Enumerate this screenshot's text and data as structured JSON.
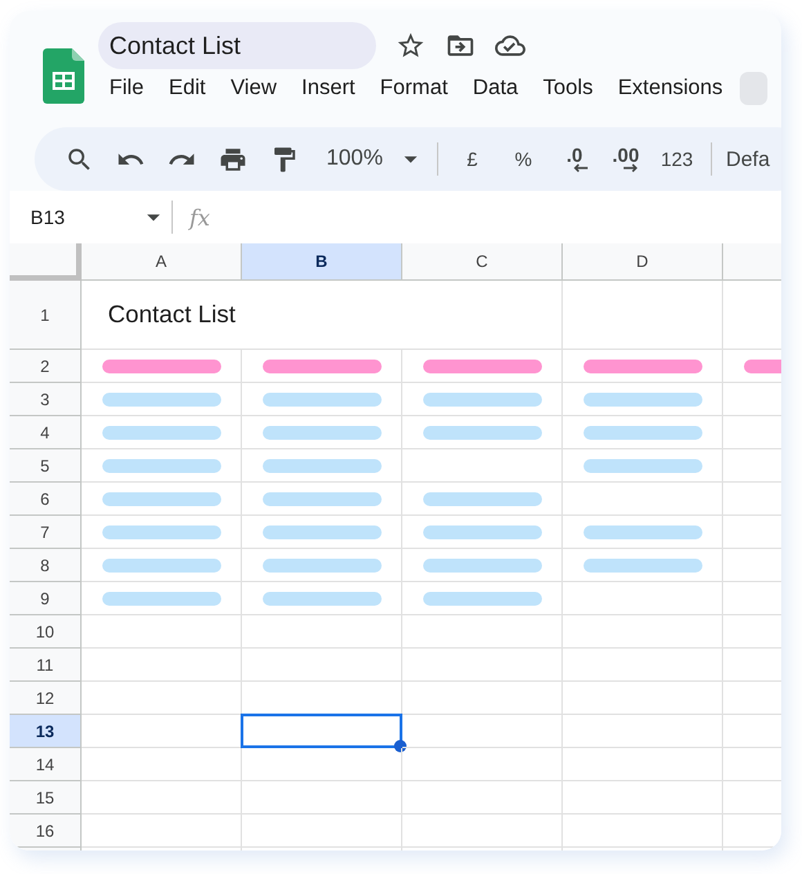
{
  "document": {
    "title": "Contact List"
  },
  "menu": [
    "File",
    "Edit",
    "View",
    "Insert",
    "Format",
    "Data",
    "Tools",
    "Extensions"
  ],
  "toolbar": [
    {
      "kind": "search"
    },
    {
      "kind": "undo"
    },
    {
      "kind": "redo"
    },
    {
      "kind": "print"
    },
    {
      "kind": "paint-format"
    },
    {
      "kind": "zoom",
      "text": "100%"
    },
    {
      "kind": "divider"
    },
    {
      "kind": "text",
      "text": "£"
    },
    {
      "kind": "text",
      "text": "%"
    },
    {
      "kind": "decimal-decrease",
      "text": ".0"
    },
    {
      "kind": "decimal-increase",
      "text": ".00"
    },
    {
      "kind": "text",
      "text": "123"
    },
    {
      "kind": "divider"
    },
    {
      "kind": "font",
      "text": "Defa"
    }
  ],
  "name_box": "B13",
  "formula_label": "fx",
  "columns": [
    {
      "label": "A",
      "selected": false
    },
    {
      "label": "B",
      "selected": true
    },
    {
      "label": "C",
      "selected": false
    },
    {
      "label": "D",
      "selected": false
    },
    {
      "selected": false
    }
  ],
  "title_row": {
    "label": "1",
    "text": "Contact List"
  },
  "rows": [
    {
      "label": "2",
      "selected": false,
      "cells": [
        {
          "kind": "header"
        },
        {
          "kind": "header"
        },
        {
          "kind": "header"
        },
        {
          "kind": "header"
        },
        {
          "kind": "header"
        }
      ]
    },
    {
      "label": "3",
      "selected": false,
      "cells": [
        {
          "kind": "value"
        },
        {
          "kind": "value"
        },
        {
          "kind": "value"
        },
        {
          "kind": "value"
        },
        {
          "kind": "blank"
        }
      ]
    },
    {
      "label": "4",
      "selected": false,
      "cells": [
        {
          "kind": "value"
        },
        {
          "kind": "value"
        },
        {
          "kind": "value"
        },
        {
          "kind": "value"
        },
        {
          "kind": "blank"
        }
      ]
    },
    {
      "label": "5",
      "selected": false,
      "cells": [
        {
          "kind": "value"
        },
        {
          "kind": "value"
        },
        {
          "kind": "blank"
        },
        {
          "kind": "value"
        },
        {
          "kind": "blank"
        }
      ]
    },
    {
      "label": "6",
      "selected": false,
      "cells": [
        {
          "kind": "value"
        },
        {
          "kind": "value"
        },
        {
          "kind": "value"
        },
        {
          "kind": "blank"
        },
        {
          "kind": "blank"
        }
      ]
    },
    {
      "label": "7",
      "selected": false,
      "cells": [
        {
          "kind": "value"
        },
        {
          "kind": "value"
        },
        {
          "kind": "value"
        },
        {
          "kind": "value"
        },
        {
          "kind": "blank"
        }
      ]
    },
    {
      "label": "8",
      "selected": false,
      "cells": [
        {
          "kind": "value"
        },
        {
          "kind": "value"
        },
        {
          "kind": "value"
        },
        {
          "kind": "value"
        },
        {
          "kind": "blank"
        }
      ]
    },
    {
      "label": "9",
      "selected": false,
      "cells": [
        {
          "kind": "value"
        },
        {
          "kind": "value"
        },
        {
          "kind": "value"
        },
        {
          "kind": "blank"
        },
        {
          "kind": "blank"
        }
      ]
    },
    {
      "label": "10",
      "selected": false,
      "cells": [
        {
          "kind": "blank"
        },
        {
          "kind": "blank"
        },
        {
          "kind": "blank"
        },
        {
          "kind": "blank"
        },
        {
          "kind": "blank"
        }
      ]
    },
    {
      "label": "11",
      "selected": false,
      "cells": [
        {
          "kind": "blank"
        },
        {
          "kind": "blank"
        },
        {
          "kind": "blank"
        },
        {
          "kind": "blank"
        },
        {
          "kind": "blank"
        }
      ]
    },
    {
      "label": "12",
      "selected": false,
      "cells": [
        {
          "kind": "blank"
        },
        {
          "kind": "blank"
        },
        {
          "kind": "blank"
        },
        {
          "kind": "blank"
        },
        {
          "kind": "blank"
        }
      ]
    },
    {
      "label": "13",
      "selected": true,
      "cells": [
        {
          "kind": "blank"
        },
        {
          "kind": "blank"
        },
        {
          "kind": "blank"
        },
        {
          "kind": "blank"
        },
        {
          "kind": "blank"
        }
      ]
    },
    {
      "label": "14",
      "selected": false,
      "cells": [
        {
          "kind": "blank"
        },
        {
          "kind": "blank"
        },
        {
          "kind": "blank"
        },
        {
          "kind": "blank"
        },
        {
          "kind": "blank"
        }
      ]
    },
    {
      "label": "15",
      "selected": false,
      "cells": [
        {
          "kind": "blank"
        },
        {
          "kind": "blank"
        },
        {
          "kind": "blank"
        },
        {
          "kind": "blank"
        },
        {
          "kind": "blank"
        }
      ]
    },
    {
      "label": "16",
      "selected": false,
      "cells": [
        {
          "kind": "blank"
        },
        {
          "kind": "blank"
        },
        {
          "kind": "blank"
        },
        {
          "kind": "blank"
        },
        {
          "kind": "blank"
        }
      ]
    }
  ]
}
